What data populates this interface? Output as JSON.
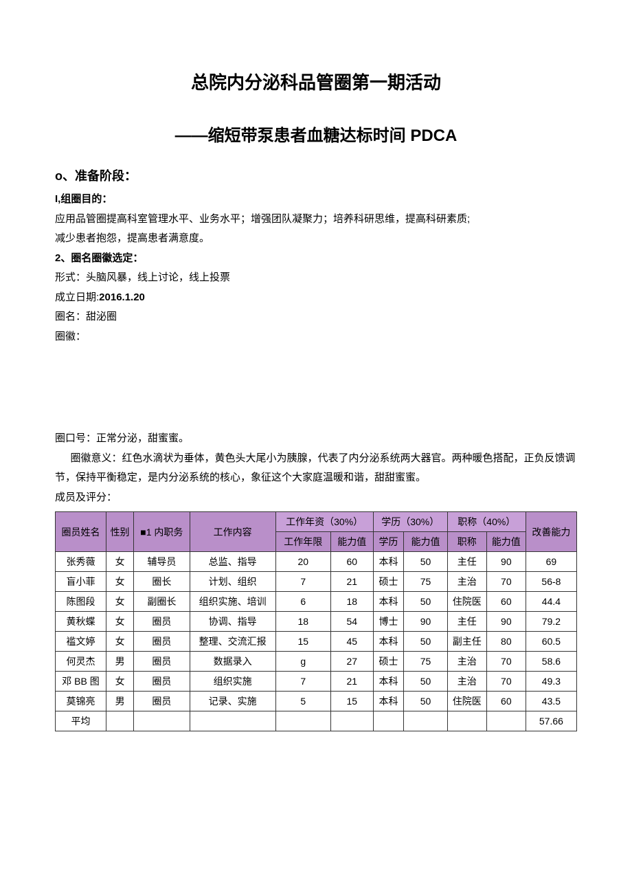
{
  "title": "总院内分泌科品管圈第一期活动",
  "subtitle": "——缩短带泵患者血糖达标时间 PDCA",
  "prep": {
    "heading": "o、准备阶段：",
    "purpose_label": "I,组圈目的：",
    "purpose_line1": "应用品管圈提高科室管理水平、业务水平；增强团队凝聚力；培养科研思维，提高科研素质;",
    "purpose_line2": "减少患者抱怨，提高患者满意度。",
    "naming_label": "2、圈名圈徽选定：",
    "form_line": "形式：头脑风暴，线上讨论，线上投票",
    "founded_label": "成立日期:",
    "founded_value": "2016.1.20",
    "circle_name_line": "圈名：甜泌圈",
    "circle_badge_line": "圈徽：",
    "slogan_line": "圈口号：正常分泌，甜蜜蜜。",
    "meaning_line": "圈徽意义：红色水滴状为垂体，黄色头大尾小为胰腺，代表了内分泌系统两大器官。两种暖色搭配，正负反馈调节，保持平衡稳定，是内分泌系统的核心，象征这个大家庭温暖和谐，甜甜蜜蜜。",
    "members_label": "成员及评分："
  },
  "table": {
    "headers": {
      "name": "圈员姓名",
      "gender": "性别",
      "role": "■1 内职务",
      "work": "工作内容",
      "tenure_group": "工作年资（30%）",
      "tenure_years": "工作年限",
      "tenure_score": "能力值",
      "edu_group": "学历（30%）",
      "edu": "学历",
      "edu_score": "能力值",
      "title_group": "职称（40%）",
      "title": "职称",
      "title_score": "能力值",
      "improve": "改善能力"
    },
    "rows": [
      {
        "name": "张秀薇",
        "gender": "女",
        "role": "辅导员",
        "work": "总监、指导",
        "years": "20",
        "yscore": "60",
        "edu": "本科",
        "escore": "50",
        "title": "主任",
        "tscore": "90",
        "improve": "69"
      },
      {
        "name": "盲小菲",
        "gender": "女",
        "role": "圈长",
        "work": "计划、组织",
        "years": "7",
        "yscore": "21",
        "edu": "硕士",
        "escore": "75",
        "title": "主治",
        "tscore": "70",
        "improve": "56-8"
      },
      {
        "name": "陈图段",
        "gender": "女",
        "role": "副圈长",
        "work": "组织实施、培训",
        "years": "6",
        "yscore": "18",
        "edu": "本科",
        "escore": "50",
        "title": "住院医",
        "tscore": "60",
        "improve": "44.4"
      },
      {
        "name": "黄秋蝶",
        "gender": "女",
        "role": "圈员",
        "work": "协调、指导",
        "years": "18",
        "yscore": "54",
        "edu": "博士",
        "escore": "90",
        "title": "主任",
        "tscore": "90",
        "improve": "79.2"
      },
      {
        "name": "褴文婷",
        "gender": "女",
        "role": "圈员",
        "work": "整理、交流汇报",
        "years": "15",
        "yscore": "45",
        "edu": "本科",
        "escore": "50",
        "title": "副主任",
        "tscore": "80",
        "improve": "60.5"
      },
      {
        "name": "何灵杰",
        "gender": "男",
        "role": "圈员",
        "work": "数据录入",
        "years": "g",
        "yscore": "27",
        "edu": "硕士",
        "escore": "75",
        "title": "主治",
        "tscore": "70",
        "improve": "58.6"
      },
      {
        "name": "邓 BB 图",
        "gender": "女",
        "role": "圈员",
        "work": "组织实施",
        "years": "7",
        "yscore": "21",
        "edu": "本科",
        "escore": "50",
        "title": "主治",
        "tscore": "70",
        "improve": "49.3"
      },
      {
        "name": "莫锦亮",
        "gender": "男",
        "role": "圈员",
        "work": "记录、实施",
        "years": "5",
        "yscore": "15",
        "edu": "本科",
        "escore": "50",
        "title": "住院医",
        "tscore": "60",
        "improve": "43.5"
      }
    ],
    "avg_label": "平均",
    "avg_value": "57.66"
  }
}
